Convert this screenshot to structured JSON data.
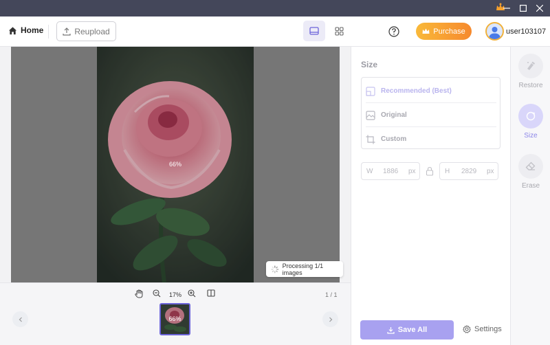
{
  "toolbar": {
    "home_label": "Home",
    "reupload_label": "Reupload",
    "purchase_label": "Purchase",
    "username": "user103107"
  },
  "canvas": {
    "progress_label": "66%",
    "processing_text": "Processing 1/1 images"
  },
  "bottom": {
    "zoom_level": "17%",
    "pager": "1 / 1",
    "thumb_progress": "66%"
  },
  "size_panel": {
    "title": "Size",
    "options": [
      {
        "label": "Recommended (Best)",
        "selected": true
      },
      {
        "label": "Original",
        "selected": false
      },
      {
        "label": "Custom",
        "selected": false
      }
    ],
    "width_label": "W",
    "width_value": "1886",
    "width_unit": "px",
    "height_label": "H",
    "height_value": "2829",
    "height_unit": "px",
    "save_all_label": "Save All",
    "settings_label": "Settings"
  },
  "tools": [
    {
      "label": "Restore",
      "active": false
    },
    {
      "label": "Size",
      "active": true
    },
    {
      "label": "Erase",
      "active": false
    }
  ],
  "colors": {
    "accent": "#6b63d9",
    "purchase_start": "#f9b93a",
    "purchase_end": "#f6892d",
    "titlebar": "#44475a"
  }
}
